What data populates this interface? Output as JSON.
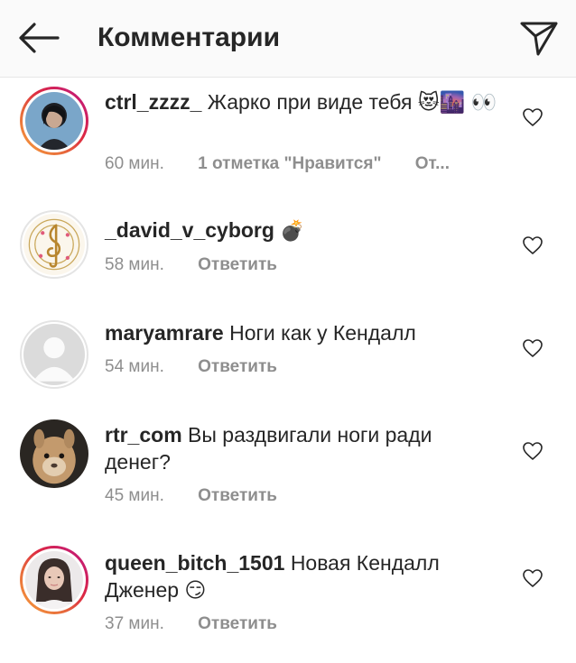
{
  "header": {
    "title": "Комментарии",
    "back_icon": "arrow-left-icon",
    "direct_icon": "paper-plane-icon"
  },
  "comments": [
    {
      "username": "ctrl_zzzz_",
      "text": "Жарко при виде тебя 😻🌆 👀",
      "time": "60 мин.",
      "likes": "1 отметка \"Нравится\"",
      "reply": "От...",
      "story_ring": true
    },
    {
      "username": "_david_v_cyborg",
      "text": "💣",
      "time": "58 мин.",
      "reply": "Ответить",
      "story_ring": false
    },
    {
      "username": "maryamrare",
      "text": "Ноги как у Кендалл",
      "time": "54 мин.",
      "reply": "Ответить",
      "story_ring": false
    },
    {
      "username": "rtr_com",
      "text": "Вы раздвигали ноги ради денег?",
      "time": "45 мин.",
      "reply": "Ответить",
      "story_ring": false
    },
    {
      "username": "queen_bitch_1501",
      "text": "Новая Кендалл Дженер 😏",
      "time": "37 мин.",
      "reply": "Ответить",
      "story_ring": true
    }
  ],
  "icons": {
    "like": "heart-outline-icon"
  },
  "colors": {
    "text": "#262626",
    "secondary": "#8e8e8e",
    "header_bg": "#fafafa",
    "story_ring": "#dc2743"
  }
}
